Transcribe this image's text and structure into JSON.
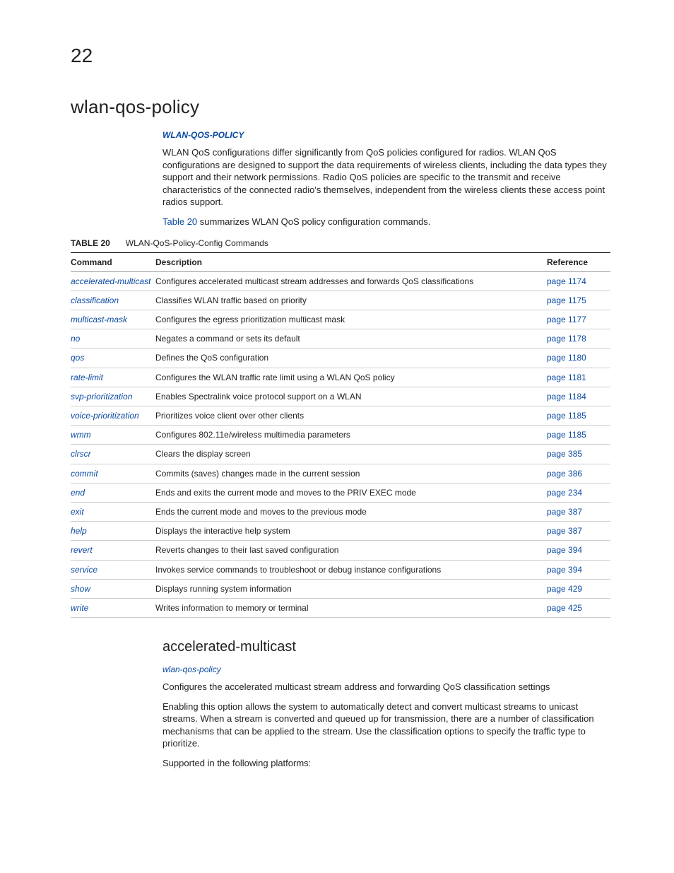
{
  "chapter_number": "22",
  "h1": "wlan-qos-policy",
  "link_header_upper": "WLAN-QOS-POLICY",
  "intro_paragraph": "WLAN QoS configurations differ significantly from QoS policies configured for radios. WLAN QoS configurations are designed to support the data requirements of wireless clients, including the data types they support and their network permissions. Radio QoS policies are specific to the transmit and receive characteristics of the connected radio's themselves, independent from the wireless clients these access point radios support.",
  "summary_sentence_prefix": "Table 20",
  "summary_sentence_rest": " summarizes WLAN QoS policy configuration commands.",
  "table_label": "TABLE 20",
  "table_title": "WLAN-QoS-Policy-Config Commands",
  "headers": {
    "c1": "Command",
    "c2": "Description",
    "c3": "Reference"
  },
  "rows": [
    {
      "cmd": "accelerated-multicast",
      "desc": "Configures accelerated multicast stream addresses and forwards QoS classifications",
      "ref": "page 1174"
    },
    {
      "cmd": "classification",
      "desc": "Classifies WLAN traffic based on priority",
      "ref": "page 1175"
    },
    {
      "cmd": "multicast-mask",
      "desc": "Configures the egress prioritization multicast mask",
      "ref": "page 1177"
    },
    {
      "cmd": "no",
      "desc": "Negates a command or sets its default",
      "ref": "page 1178"
    },
    {
      "cmd": "qos",
      "desc": "Defines the QoS configuration",
      "ref": "page 1180"
    },
    {
      "cmd": "rate-limit",
      "desc": "Configures the WLAN traffic rate limit using a WLAN QoS policy",
      "ref": "page 1181"
    },
    {
      "cmd": "svp-prioritization",
      "desc": "Enables Spectralink voice protocol support on a WLAN",
      "ref": "page 1184"
    },
    {
      "cmd": "voice-prioritization",
      "desc": "Prioritizes voice client over other clients",
      "ref": "page 1185"
    },
    {
      "cmd": "wmm",
      "desc": "Configures 802.11e/wireless multimedia parameters",
      "ref": "page 1185"
    },
    {
      "cmd": "clrscr",
      "desc": "Clears the display screen",
      "ref": "page 385"
    },
    {
      "cmd": "commit",
      "desc": "Commits (saves) changes made in the current session",
      "ref": "page 386"
    },
    {
      "cmd": "end",
      "desc": "Ends and exits the current mode and moves to the PRIV EXEC mode",
      "ref": "page 234"
    },
    {
      "cmd": "exit",
      "desc": "Ends the current mode and moves to the previous mode",
      "ref": "page 387"
    },
    {
      "cmd": "help",
      "desc": "Displays the interactive help system",
      "ref": "page 387"
    },
    {
      "cmd": "revert",
      "desc": "Reverts changes to their last saved configuration",
      "ref": "page 394"
    },
    {
      "cmd": "service",
      "desc": "Invokes service commands to troubleshoot or debug instance configurations",
      "ref": "page 394"
    },
    {
      "cmd": "show",
      "desc": "Displays running system information",
      "ref": "page 429"
    },
    {
      "cmd": "write",
      "desc": "Writes information to memory or terminal",
      "ref": "page 425"
    }
  ],
  "subsection_title": "accelerated-multicast",
  "subsection_link": "wlan-qos-policy",
  "sub_p1": "Configures the accelerated multicast stream address and forwarding QoS classification settings",
  "sub_p2": "Enabling this option allows the system to automatically detect and convert multicast streams to unicast streams. When a stream is converted and queued up for transmission, there are a number of classification mechanisms that can be applied to the stream. Use the classification options to specify the traffic type to prioritize.",
  "sub_p3": "Supported in the following platforms:"
}
